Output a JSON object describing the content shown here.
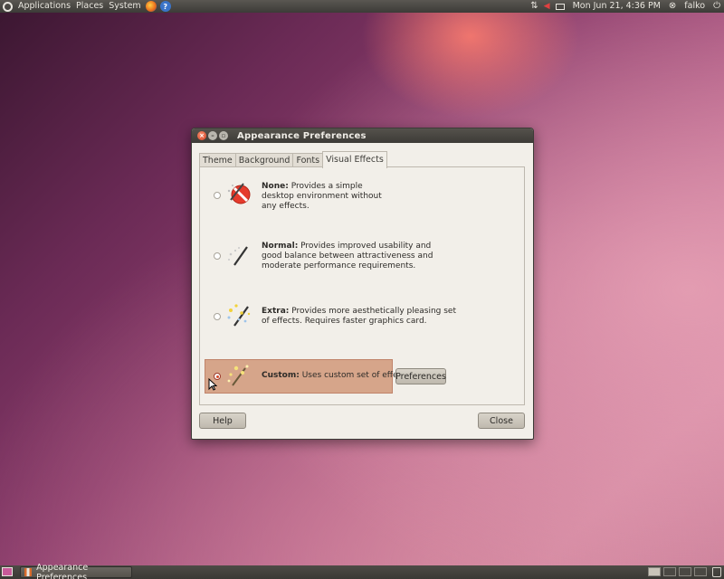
{
  "top_panel": {
    "menus": [
      "Applications",
      "Places",
      "System"
    ],
    "clock": "Mon Jun 21,  4:36 PM",
    "user": "falko"
  },
  "dialog": {
    "title": "Appearance Preferences",
    "tabs": [
      {
        "label": "Theme",
        "active": false
      },
      {
        "label": "Background",
        "active": false
      },
      {
        "label": "Fonts",
        "active": false
      },
      {
        "label": "Visual Effects",
        "active": true
      }
    ],
    "options": [
      {
        "name": "None:",
        "line1": " Provides a simple",
        "line2": "desktop environment without",
        "line3": "any effects.",
        "selected": false
      },
      {
        "name": "Normal:",
        "line1": " Provides improved usability and",
        "line2": "good balance between attractiveness and",
        "line3": "moderate performance requirements.",
        "selected": false
      },
      {
        "name": "Extra:",
        "line1": " Provides more aesthetically pleasing set",
        "line2": "of effects. Requires faster graphics card.",
        "line3": "",
        "selected": false
      },
      {
        "name": "Custom:",
        "line1": " Uses custom set of effects.",
        "line2": "",
        "line3": "",
        "selected": true
      }
    ],
    "preferences_label": "Preferences",
    "help_label": "Help",
    "close_label": "Close"
  },
  "bottom_panel": {
    "task_label": "Appearance Preferences"
  },
  "colors": {
    "selection": "#d6a58a",
    "panel": "#3c3b37",
    "dialog_bg": "#f2efe9"
  }
}
